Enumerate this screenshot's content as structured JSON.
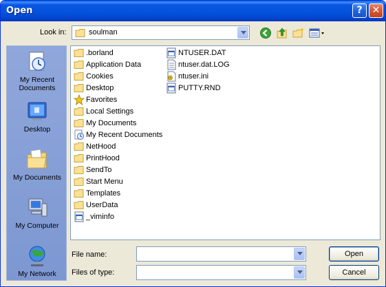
{
  "window": {
    "title": "Open",
    "help_label": "?",
    "close_label": "✕"
  },
  "lookin": {
    "label": "Look in:",
    "value": "soulman"
  },
  "places": [
    {
      "label_line1": "My Recent",
      "label_line2": "Documents"
    },
    {
      "label_line1": "Desktop",
      "label_line2": ""
    },
    {
      "label_line1": "My Documents",
      "label_line2": ""
    },
    {
      "label_line1": "My Computer",
      "label_line2": ""
    },
    {
      "label_line1": "My Network",
      "label_line2": ""
    }
  ],
  "files": [
    {
      "name": ".borland",
      "icon": "folder-icon"
    },
    {
      "name": "Application Data",
      "icon": "folder-icon"
    },
    {
      "name": "Cookies",
      "icon": "folder-icon"
    },
    {
      "name": "Desktop",
      "icon": "folder-icon"
    },
    {
      "name": "Favorites",
      "icon": "star-icon"
    },
    {
      "name": "Local Settings",
      "icon": "folder-icon"
    },
    {
      "name": "My Documents",
      "icon": "folder-icon"
    },
    {
      "name": "My Recent Documents",
      "icon": "recent-icon"
    },
    {
      "name": "NetHood",
      "icon": "folder-icon"
    },
    {
      "name": "PrintHood",
      "icon": "folder-icon"
    },
    {
      "name": "SendTo",
      "icon": "folder-icon"
    },
    {
      "name": "Start Menu",
      "icon": "folder-icon"
    },
    {
      "name": "Templates",
      "icon": "folder-icon"
    },
    {
      "name": "UserData",
      "icon": "folder-icon"
    },
    {
      "name": "_viminfo",
      "icon": "file-icon"
    },
    {
      "name": "NTUSER.DAT",
      "icon": "file-icon"
    },
    {
      "name": "ntuser.dat.LOG",
      "icon": "text-file-icon"
    },
    {
      "name": "ntuser.ini",
      "icon": "ini-file-icon"
    },
    {
      "name": "PUTTY.RND",
      "icon": "file-icon"
    }
  ],
  "filename": {
    "label": "File name:",
    "value": ""
  },
  "filetype": {
    "label": "Files of type:",
    "value": ""
  },
  "buttons": {
    "open": "Open",
    "cancel": "Cancel"
  },
  "colors": {
    "title_bar": "#0453dc",
    "places_bar": "#7f9bd6",
    "dialog_bg": "#ece9d8"
  }
}
